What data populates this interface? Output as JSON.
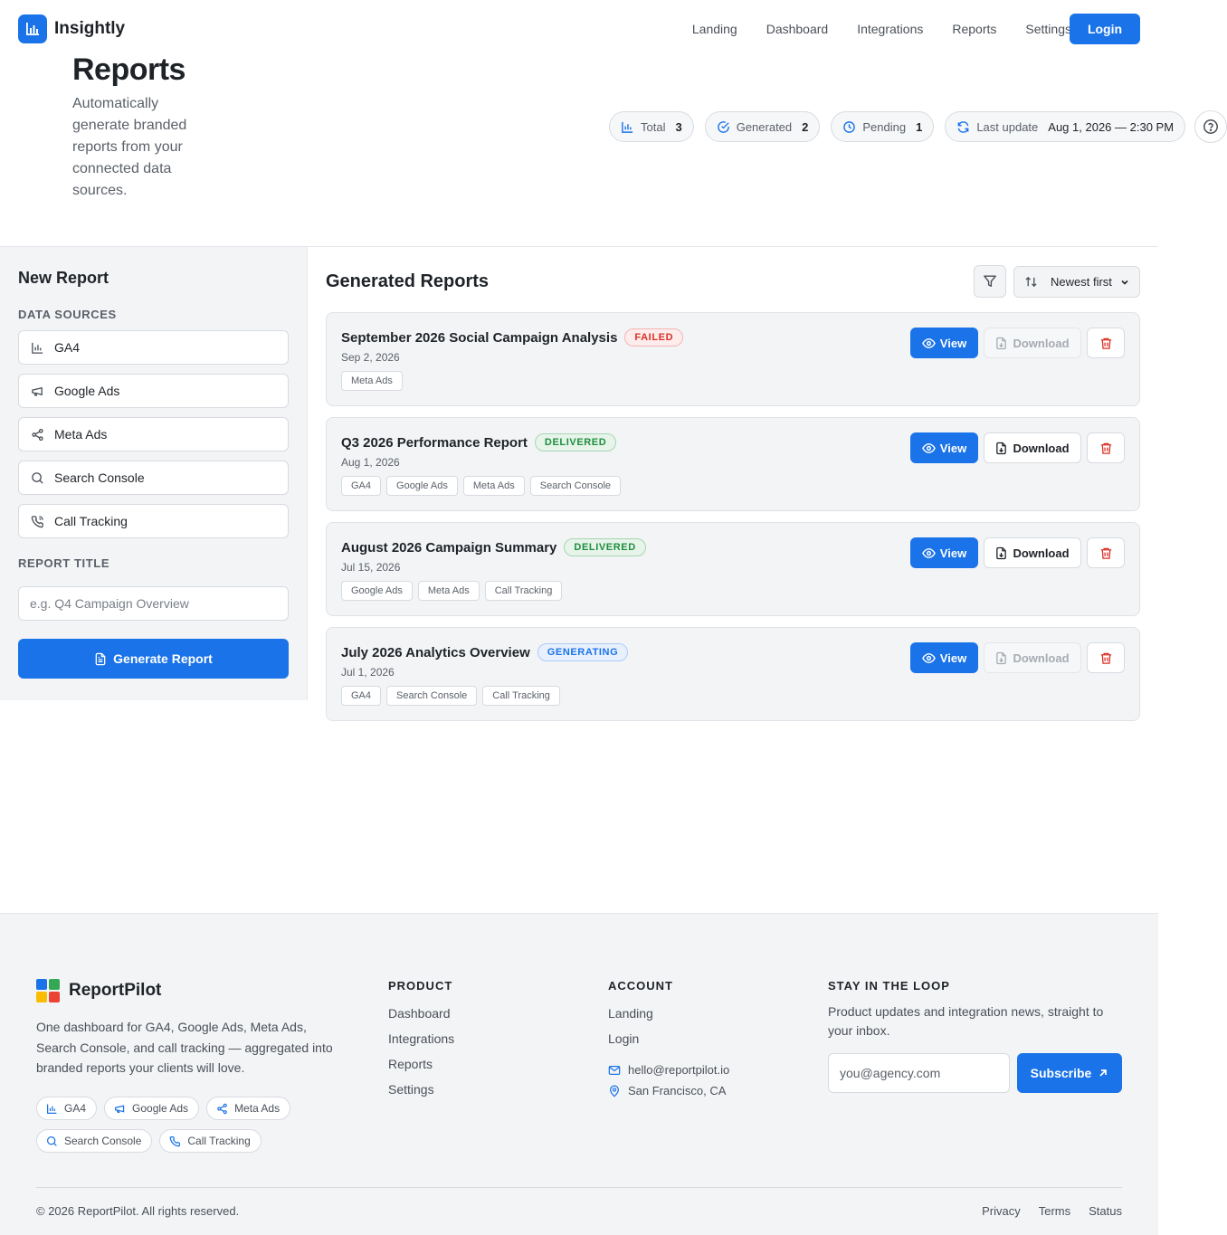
{
  "brand": {
    "name": "Insightly"
  },
  "nav": {
    "items": [
      "Landing",
      "Dashboard",
      "Integrations",
      "Reports",
      "Settings"
    ],
    "login_label": "Login"
  },
  "page": {
    "title": "Reports",
    "subtitle": "Automatically generate branded reports from your connected data sources."
  },
  "stats": {
    "total_label": "Total",
    "total_value": "3",
    "generated_label": "Generated",
    "generated_value": "2",
    "pending_label": "Pending",
    "pending_value": "1",
    "last_update_label": "Last update",
    "last_update_value": "Aug 1, 2026 — 2:30 PM"
  },
  "sidebar": {
    "title": "New Report",
    "sources_label": "DATA SOURCES",
    "sources": [
      {
        "label": "GA4",
        "icon": "bar-chart-icon"
      },
      {
        "label": "Google Ads",
        "icon": "megaphone-icon"
      },
      {
        "label": "Meta Ads",
        "icon": "share-icon"
      },
      {
        "label": "Search Console",
        "icon": "search-icon"
      },
      {
        "label": "Call Tracking",
        "icon": "phone-icon"
      }
    ],
    "report_title_label": "REPORT TITLE",
    "report_title_placeholder": "e.g. Q4 Campaign Overview",
    "report_title_value": "",
    "generate_label": "Generate Report"
  },
  "reports": {
    "title": "Generated Reports",
    "sort_label": "Newest first",
    "view_label": "View",
    "download_label": "Download",
    "items": [
      {
        "title": "September 2026 Social Campaign Analysis",
        "status": "FAILED",
        "date": "Sep 2, 2026",
        "tags": [
          "Meta Ads"
        ]
      },
      {
        "title": "Q3 2026 Performance Report",
        "status": "DELIVERED",
        "date": "Aug 1, 2026",
        "tags": [
          "GA4",
          "Google Ads",
          "Meta Ads",
          "Search Console"
        ]
      },
      {
        "title": "August 2026 Campaign Summary",
        "status": "DELIVERED",
        "date": "Jul 15, 2026",
        "tags": [
          "Google Ads",
          "Meta Ads",
          "Call Tracking"
        ]
      },
      {
        "title": "July 2026 Analytics Overview",
        "status": "GENERATING",
        "date": "Jul 1, 2026",
        "tags": [
          "GA4",
          "Search Console",
          "Call Tracking"
        ]
      }
    ]
  },
  "footer": {
    "brand_name": "ReportPilot",
    "description": "One dashboard for GA4, Google Ads, Meta Ads, Search Console, and call tracking — aggregated into branded reports your clients will love.",
    "chips": [
      "GA4",
      "Google Ads",
      "Meta Ads",
      "Search Console",
      "Call Tracking"
    ],
    "product_title": "PRODUCT",
    "product_links": [
      "Dashboard",
      "Integrations",
      "Reports",
      "Settings"
    ],
    "account_title": "ACCOUNT",
    "account_links": [
      "Landing",
      "Login"
    ],
    "email": "hello@reportpilot.io",
    "location": "San Francisco, CA",
    "loop_title": "STAY IN THE LOOP",
    "loop_desc": "Product updates and integration news, straight to your inbox.",
    "email_placeholder": "you@agency.com",
    "subscribe_label": "Subscribe",
    "copyright": "© 2026 ReportPilot. All rights reserved.",
    "legal": [
      "Privacy",
      "Terms",
      "Status"
    ]
  },
  "colors": {
    "primary": "#1a73e8",
    "danger": "#d93025",
    "success": "#1e8e3e"
  }
}
